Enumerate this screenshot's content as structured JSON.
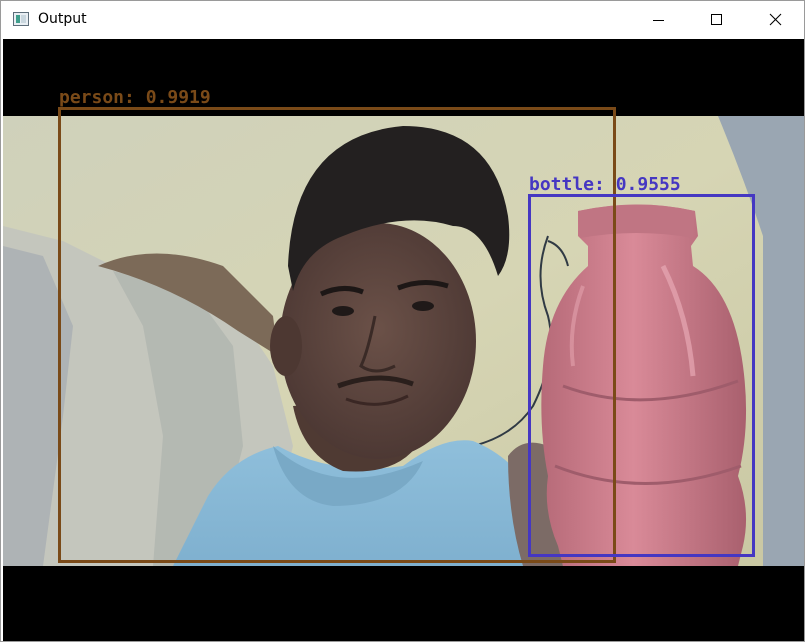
{
  "window": {
    "title": "Output",
    "controls": {
      "minimize_icon": "minimize-icon",
      "maximize_icon": "maximize-icon",
      "close_icon": "close-icon"
    }
  },
  "detections": [
    {
      "label": "person: 0.9919",
      "class": "person",
      "score": 0.9919,
      "color": "#7a4a18"
    },
    {
      "label": "bottle: 0.9555",
      "class": "bottle",
      "score": 0.9555,
      "color": "#4537c2"
    }
  ],
  "colors": {
    "letterbox": "#000000",
    "titlebar": "#ffffff"
  }
}
